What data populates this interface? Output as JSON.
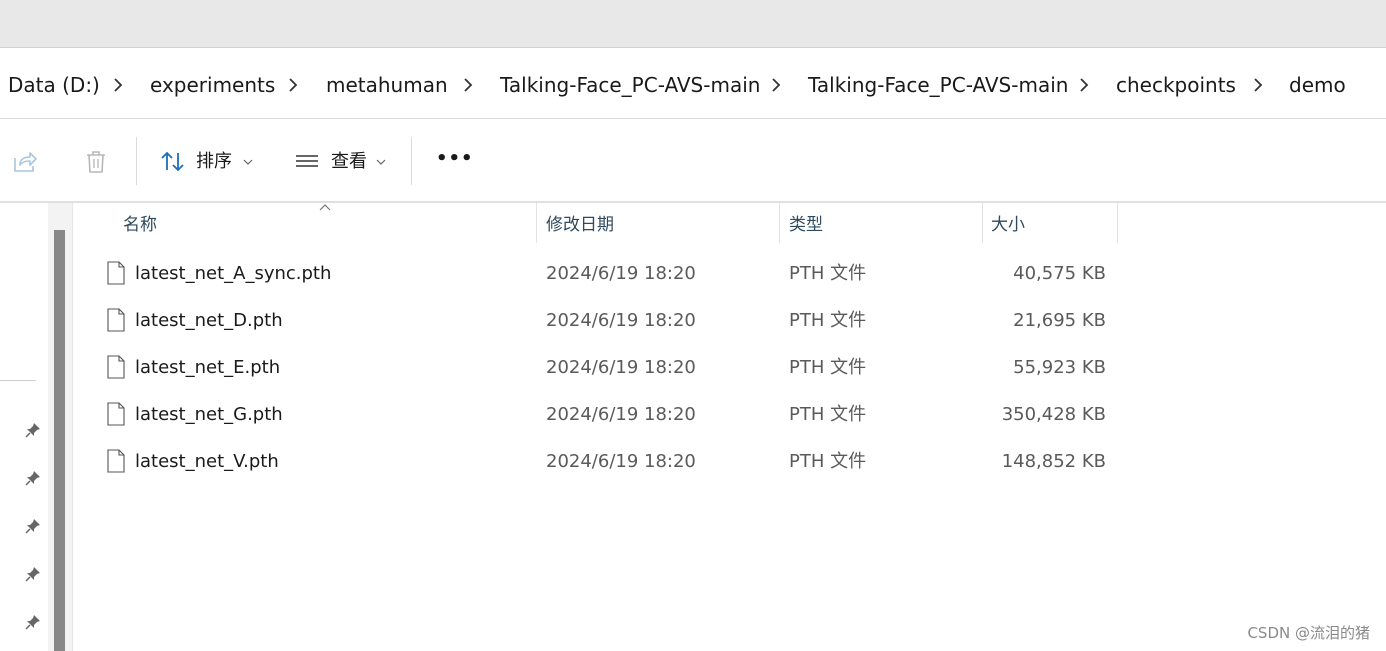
{
  "breadcrumb": {
    "items": [
      "Data (D:)",
      "experiments",
      "metahuman",
      "Talking-Face_PC-AVS-main",
      "Talking-Face_PC-AVS-main",
      "checkpoints",
      "demo"
    ]
  },
  "toolbar": {
    "sort_label": "排序",
    "view_label": "查看",
    "more_label": "•••"
  },
  "columns": {
    "name": "名称",
    "date": "修改日期",
    "type": "类型",
    "size": "大小"
  },
  "files": [
    {
      "name": "latest_net_A_sync.pth",
      "date": "2024/6/19 18:20",
      "type": "PTH 文件",
      "size": "40,575 KB"
    },
    {
      "name": "latest_net_D.pth",
      "date": "2024/6/19 18:20",
      "type": "PTH 文件",
      "size": "21,695 KB"
    },
    {
      "name": "latest_net_E.pth",
      "date": "2024/6/19 18:20",
      "type": "PTH 文件",
      "size": "55,923 KB"
    },
    {
      "name": "latest_net_G.pth",
      "date": "2024/6/19 18:20",
      "type": "PTH 文件",
      "size": "350,428 KB"
    },
    {
      "name": "latest_net_V.pth",
      "date": "2024/6/19 18:20",
      "type": "PTH 文件",
      "size": "148,852 KB"
    }
  ],
  "watermark": "CSDN @流泪的猪",
  "icons": {
    "share": "share-icon",
    "delete": "trash-icon",
    "sort": "sort-icon",
    "view": "view-list-icon",
    "pin": "pin-icon",
    "file": "file-icon",
    "chevron": "chevron-right-icon"
  },
  "colors": {
    "header_text": "#2f4a5c",
    "secondary_text": "#5a5a5a",
    "sort_icon": "#1f6fb5"
  }
}
